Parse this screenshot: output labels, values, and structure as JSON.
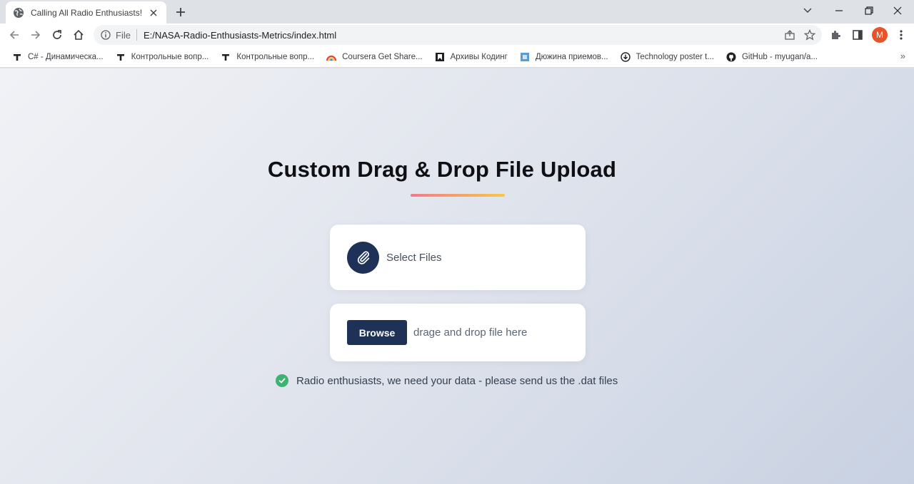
{
  "browser": {
    "tab": {
      "title": "Calling All Radio Enthusiasts!",
      "favicon": "globe-icon"
    },
    "address": {
      "scheme": "File",
      "url": "E:/NASA-Radio-Enthusiasts-Metrics/index.html"
    },
    "profile_initial": "M",
    "profile_color": "#e8532a",
    "bookmarks": [
      {
        "label": "C# - Динамическа...",
        "icon": "t-letter-icon"
      },
      {
        "label": "Контрольные вопр...",
        "icon": "t-letter-icon"
      },
      {
        "label": "Контрольные вопр...",
        "icon": "t-letter-icon"
      },
      {
        "label": "Coursera Get Share...",
        "icon": "rainbow-icon"
      },
      {
        "label": "Архивы Кодинг",
        "icon": "book-icon"
      },
      {
        "label": "Дюжина приемов...",
        "icon": "blue-square-icon"
      },
      {
        "label": "Technology poster t...",
        "icon": "download-circle-icon"
      },
      {
        "label": "GitHub - myugan/a...",
        "icon": "github-icon"
      }
    ],
    "bookmarks_overflow": "»"
  },
  "page": {
    "heading": "Custom Drag & Drop File Upload",
    "select_files_label": "Select Files",
    "browse_label": "Browse",
    "drop_hint": "drage and drop file here",
    "notice": "Radio enthusiasts, we need your data - please send us the .dat files",
    "accent_color": "#1e3258",
    "success_color": "#3cb371"
  }
}
